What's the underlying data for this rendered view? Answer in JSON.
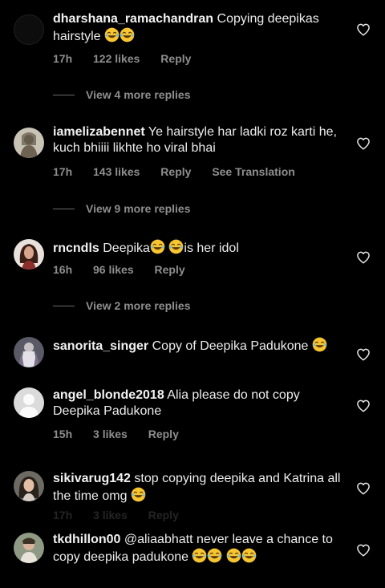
{
  "comments": [
    {
      "username": "dharshana_ramachandran",
      "text": "Copying deepikas hairstyle",
      "time": "17h",
      "likes": "122 likes",
      "reply": "Reply"
    },
    {
      "username": "iamelizabennet",
      "text": "Ye hairstyle har ladki roz karti he, kuch bhiiii likhte ho viral bhai",
      "time": "17h",
      "likes": "143 likes",
      "reply": "Reply",
      "translate": "See Translation"
    },
    {
      "username": "rncndls",
      "text_a": "Deepika",
      "text_b": "is her idol",
      "time": "16h",
      "likes": "96 likes",
      "reply": "Reply"
    },
    {
      "username": "sanorita_singer",
      "text": "Copy of Deepika Padukone"
    },
    {
      "username": "angel_blonde2018",
      "text": "Alia please do not copy Deepika Padukone",
      "time": "15h",
      "likes": "3 likes",
      "reply": "Reply"
    },
    {
      "username": "sikivarug142",
      "text": "stop copying deepika and Katrina all the time omg",
      "time": "17h",
      "likes": "3 likes",
      "reply": "Reply"
    },
    {
      "username": "tkdhillon00",
      "text": "@aliaabhatt never leave a chance to copy deepika padukone"
    }
  ],
  "view_replies": [
    "View 4 more replies",
    "View 9 more replies",
    "View 2 more replies"
  ],
  "icons": {
    "like": "heart-outline-icon",
    "emoji": "face-with-tears-of-joy"
  },
  "colors": {
    "background": "#000000",
    "text": "#ececec",
    "meta": "#8e8e8e"
  }
}
